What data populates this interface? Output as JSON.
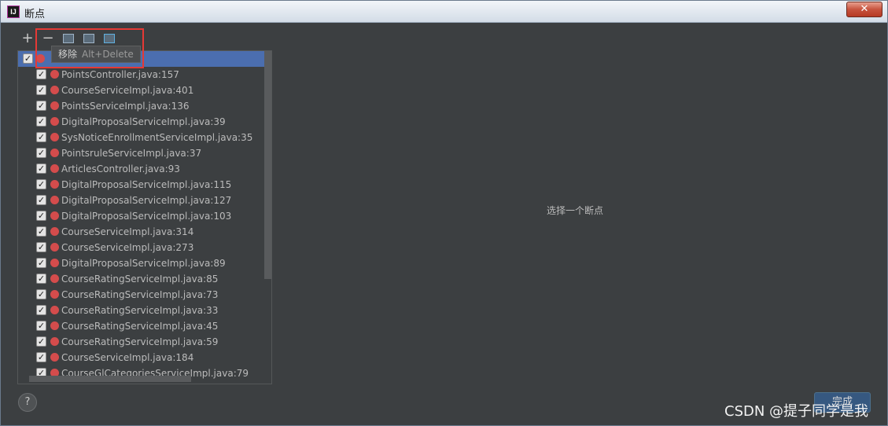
{
  "window": {
    "title": "断点",
    "app_icon_text": "IJ",
    "close_glyph": "✕"
  },
  "toolbar": {
    "add_glyph": "+",
    "remove_glyph": "−",
    "tooltip": {
      "label": "移除",
      "shortcut": "Alt+Delete"
    }
  },
  "tree": {
    "items": [
      {
        "label": "PointsController.java:157"
      },
      {
        "label": "CourseServiceImpl.java:401"
      },
      {
        "label": "PointsServiceImpl.java:136"
      },
      {
        "label": "DigitalProposalServiceImpl.java:39"
      },
      {
        "label": "SysNoticeEnrollmentServiceImpl.java:35"
      },
      {
        "label": "PointsruleServiceImpl.java:37"
      },
      {
        "label": "ArticlesController.java:93"
      },
      {
        "label": "DigitalProposalServiceImpl.java:115"
      },
      {
        "label": "DigitalProposalServiceImpl.java:127"
      },
      {
        "label": "DigitalProposalServiceImpl.java:103"
      },
      {
        "label": "CourseServiceImpl.java:314"
      },
      {
        "label": "CourseServiceImpl.java:273"
      },
      {
        "label": "DigitalProposalServiceImpl.java:89"
      },
      {
        "label": "CourseRatingServiceImpl.java:85"
      },
      {
        "label": "CourseRatingServiceImpl.java:73"
      },
      {
        "label": "CourseRatingServiceImpl.java:33"
      },
      {
        "label": "CourseRatingServiceImpl.java:45"
      },
      {
        "label": "CourseRatingServiceImpl.java:59"
      },
      {
        "label": "CourseServiceImpl.java:184"
      },
      {
        "label": "CourseGlCategoriesServiceImpl.java:79"
      }
    ]
  },
  "detail": {
    "placeholder": "选择一个断点"
  },
  "footer": {
    "help_glyph": "?",
    "done_label": "完成"
  },
  "watermark": "CSDN @提子同学是我",
  "colors": {
    "breakpoint": "#d44c4c",
    "selection": "#4b6eaf",
    "highlight": "#e53935"
  }
}
